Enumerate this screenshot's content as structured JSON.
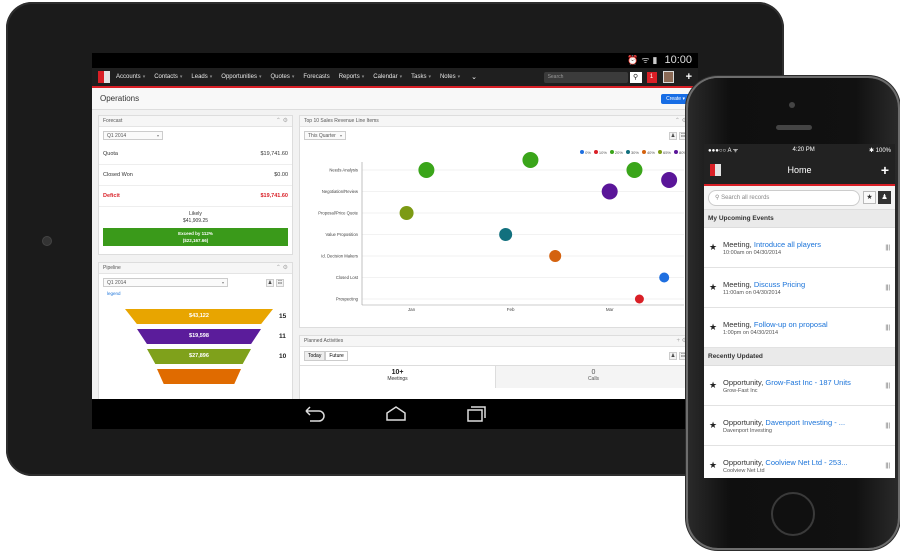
{
  "tablet": {
    "status_time": "10:00",
    "nav": {
      "items": [
        "Accounts",
        "Contacts",
        "Leads",
        "Opportunities",
        "Quotes",
        "Forecasts",
        "Reports",
        "Calendar",
        "Tasks",
        "Notes"
      ],
      "search_placeholder": "Search",
      "notify_count": "1"
    },
    "page_title": "Operations",
    "create_label": "Create",
    "forecast": {
      "title": "Forecast",
      "period": "Q1 2014",
      "rows": [
        {
          "label": "Quota",
          "value": "$19,741.60"
        },
        {
          "label": "Closed Won",
          "value": "$0.00"
        },
        {
          "label": "Deficit",
          "value": "$19,741.60"
        }
      ],
      "likely_label": "Likely",
      "likely_value": "$41,909.25",
      "exceed_line1": "Exceed by 112%",
      "exceed_line2": "($22,167.66)"
    },
    "pipeline": {
      "title": "Pipeline",
      "period": "Q1 2014",
      "legend_link": "legend",
      "segments": [
        {
          "value": "$43,122",
          "count": "15",
          "color": "#e8a500"
        },
        {
          "value": "$19,598",
          "count": "11",
          "color": "#5b1c9b"
        },
        {
          "value": "$27,896",
          "count": "10",
          "color": "#7fa11b"
        },
        {
          "value": "",
          "count": "",
          "color": "#e06b00"
        }
      ]
    },
    "top10": {
      "title": "Top 10 Sales Revenue Line Items",
      "filter": "This Quarter"
    },
    "planned": {
      "title": "Planned Activities",
      "tab_today": "Today",
      "tab_future": "Future",
      "meetings_count": "10+",
      "meetings_label": "Meetings",
      "calls_count": "0",
      "calls_label": "Calls"
    }
  },
  "chart_data": {
    "type": "scatter",
    "title": "Top 10 Sales Revenue Line Items",
    "categories": [
      "Needs Analysis",
      "Negotiation/Review",
      "Proposal/Price Quote",
      "Value Proposition",
      "Id. Decision Makers",
      "Closed Lost",
      "Prospecting"
    ],
    "x_ticks": [
      "Jan",
      "Feb",
      "Mar"
    ],
    "legend": [
      {
        "label": "0%",
        "color": "#1f6fe0"
      },
      {
        "label": "10%",
        "color": "#d91f26"
      },
      {
        "label": "20%",
        "color": "#3aa51a"
      },
      {
        "label": "30%",
        "color": "#12707e"
      },
      {
        "label": "40%",
        "color": "#d4620f"
      },
      {
        "label": "65%",
        "color": "#7c9a14"
      },
      {
        "label": "80%",
        "color": "#5a1599"
      }
    ],
    "points": [
      {
        "stage": "Needs Analysis",
        "x": 0.15,
        "size": 8,
        "color": "#3aa51a"
      },
      {
        "stage": "Needs Analysis",
        "x": 1.2,
        "size": 8,
        "color": "#3aa51a",
        "row_offset": -1
      },
      {
        "stage": "Needs Analysis",
        "x": 2.25,
        "size": 8,
        "color": "#3aa51a"
      },
      {
        "stage": "Needs Analysis",
        "x": 2.6,
        "size": 8,
        "color": "#5a1599",
        "row_offset": 1
      },
      {
        "stage": "Negotiation/Review",
        "x": 2.0,
        "size": 8,
        "color": "#5a1599"
      },
      {
        "stage": "Proposal/Price Quote",
        "x": -0.05,
        "size": 7,
        "color": "#7c9a14"
      },
      {
        "stage": "Value Proposition",
        "x": 0.95,
        "size": 6.5,
        "color": "#12707e"
      },
      {
        "stage": "Id. Decision Makers",
        "x": 1.45,
        "size": 6,
        "color": "#d4620f"
      },
      {
        "stage": "Closed Lost",
        "x": 2.55,
        "size": 5,
        "color": "#1f6fe0"
      },
      {
        "stage": "Prospecting",
        "x": 2.3,
        "size": 4.5,
        "color": "#d91f26"
      }
    ]
  },
  "phone": {
    "carrier": "●●●○○ A ᯤ",
    "time": "4:20 PM",
    "battery": "✱ 100%",
    "title": "Home",
    "search_placeholder": "Search all records",
    "upcoming_title": "My Upcoming Events",
    "events": [
      {
        "type": "Meeting,",
        "name": "Introduce all players",
        "when": "10:00am on 04/30/2014"
      },
      {
        "type": "Meeting,",
        "name": "Discuss Pricing",
        "when": "11:00am on 04/30/2014"
      },
      {
        "type": "Meeting,",
        "name": "Follow-up on proposal",
        "when": "1:00pm on 04/30/2014"
      }
    ],
    "recent_title": "Recently Updated",
    "recent": [
      {
        "type": "Opportunity,",
        "name": "Grow-Fast Inc - 187 Units",
        "account": "Grow-Fast Inc"
      },
      {
        "type": "Opportunity,",
        "name": "Davenport Investing - ...",
        "account": "Davenport Investing"
      },
      {
        "type": "Opportunity,",
        "name": "Coolview Net Ltd - 253...",
        "account": "Coolview Net Ltd"
      }
    ]
  }
}
